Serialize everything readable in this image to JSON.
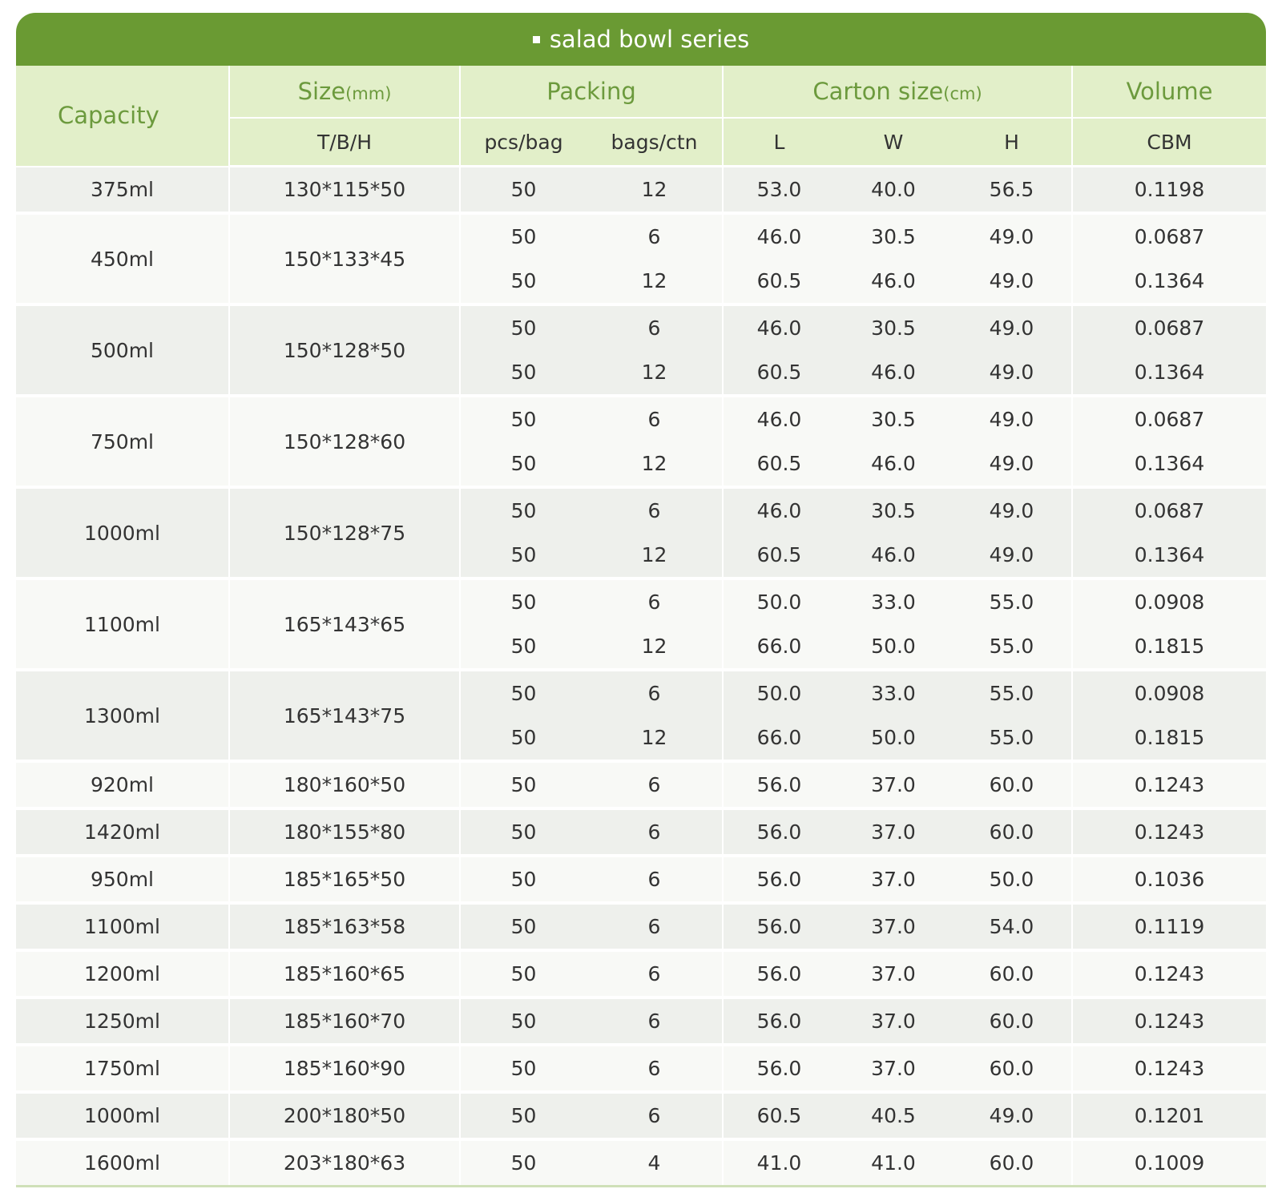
{
  "title": "salad bowl series",
  "header": {
    "capacity": "Capacity",
    "size": "Size",
    "size_unit": "(mm)",
    "size_sub": "T/B/H",
    "packing": "Packing",
    "pcs_bag": "pcs/bag",
    "bags_ctn": "bags/ctn",
    "carton": "Carton size",
    "carton_unit": "(cm)",
    "L": "L",
    "W": "W",
    "H": "H",
    "volume": "Volume",
    "cbm": "CBM"
  },
  "groups": [
    {
      "capacity": "375ml",
      "size": "130*115*50",
      "rows": [
        {
          "pcs": "50",
          "bags": "12",
          "l": "53.0",
          "w": "40.0",
          "h": "56.5",
          "cbm": "0.1198"
        }
      ]
    },
    {
      "capacity": "450ml",
      "size": "150*133*45",
      "rows": [
        {
          "pcs": "50",
          "bags": "6",
          "l": "46.0",
          "w": "30.5",
          "h": "49.0",
          "cbm": "0.0687"
        },
        {
          "pcs": "50",
          "bags": "12",
          "l": "60.5",
          "w": "46.0",
          "h": "49.0",
          "cbm": "0.1364"
        }
      ]
    },
    {
      "capacity": "500ml",
      "size": "150*128*50",
      "rows": [
        {
          "pcs": "50",
          "bags": "6",
          "l": "46.0",
          "w": "30.5",
          "h": "49.0",
          "cbm": "0.0687"
        },
        {
          "pcs": "50",
          "bags": "12",
          "l": "60.5",
          "w": "46.0",
          "h": "49.0",
          "cbm": "0.1364"
        }
      ]
    },
    {
      "capacity": "750ml",
      "size": "150*128*60",
      "rows": [
        {
          "pcs": "50",
          "bags": "6",
          "l": "46.0",
          "w": "30.5",
          "h": "49.0",
          "cbm": "0.0687"
        },
        {
          "pcs": "50",
          "bags": "12",
          "l": "60.5",
          "w": "46.0",
          "h": "49.0",
          "cbm": "0.1364"
        }
      ]
    },
    {
      "capacity": "1000ml",
      "size": "150*128*75",
      "rows": [
        {
          "pcs": "50",
          "bags": "6",
          "l": "46.0",
          "w": "30.5",
          "h": "49.0",
          "cbm": "0.0687"
        },
        {
          "pcs": "50",
          "bags": "12",
          "l": "60.5",
          "w": "46.0",
          "h": "49.0",
          "cbm": "0.1364"
        }
      ]
    },
    {
      "capacity": "1100ml",
      "size": "165*143*65",
      "rows": [
        {
          "pcs": "50",
          "bags": "6",
          "l": "50.0",
          "w": "33.0",
          "h": "55.0",
          "cbm": "0.0908"
        },
        {
          "pcs": "50",
          "bags": "12",
          "l": "66.0",
          "w": "50.0",
          "h": "55.0",
          "cbm": "0.1815"
        }
      ]
    },
    {
      "capacity": "1300ml",
      "size": "165*143*75",
      "rows": [
        {
          "pcs": "50",
          "bags": "6",
          "l": "50.0",
          "w": "33.0",
          "h": "55.0",
          "cbm": "0.0908"
        },
        {
          "pcs": "50",
          "bags": "12",
          "l": "66.0",
          "w": "50.0",
          "h": "55.0",
          "cbm": "0.1815"
        }
      ]
    },
    {
      "capacity": "920ml",
      "size": "180*160*50",
      "rows": [
        {
          "pcs": "50",
          "bags": "6",
          "l": "56.0",
          "w": "37.0",
          "h": "60.0",
          "cbm": "0.1243"
        }
      ]
    },
    {
      "capacity": "1420ml",
      "size": "180*155*80",
      "rows": [
        {
          "pcs": "50",
          "bags": "6",
          "l": "56.0",
          "w": "37.0",
          "h": "60.0",
          "cbm": "0.1243"
        }
      ]
    },
    {
      "capacity": "950ml",
      "size": "185*165*50",
      "rows": [
        {
          "pcs": "50",
          "bags": "6",
          "l": "56.0",
          "w": "37.0",
          "h": "50.0",
          "cbm": "0.1036"
        }
      ]
    },
    {
      "capacity": "1100ml",
      "size": "185*163*58",
      "rows": [
        {
          "pcs": "50",
          "bags": "6",
          "l": "56.0",
          "w": "37.0",
          "h": "54.0",
          "cbm": "0.1119"
        }
      ]
    },
    {
      "capacity": "1200ml",
      "size": "185*160*65",
      "rows": [
        {
          "pcs": "50",
          "bags": "6",
          "l": "56.0",
          "w": "37.0",
          "h": "60.0",
          "cbm": "0.1243"
        }
      ]
    },
    {
      "capacity": "1250ml",
      "size": "185*160*70",
      "rows": [
        {
          "pcs": "50",
          "bags": "6",
          "l": "56.0",
          "w": "37.0",
          "h": "60.0",
          "cbm": "0.1243"
        }
      ]
    },
    {
      "capacity": "1750ml",
      "size": "185*160*90",
      "rows": [
        {
          "pcs": "50",
          "bags": "6",
          "l": "56.0",
          "w": "37.0",
          "h": "60.0",
          "cbm": "0.1243"
        }
      ]
    },
    {
      "capacity": "1000ml",
      "size": "200*180*50",
      "rows": [
        {
          "pcs": "50",
          "bags": "6",
          "l": "60.5",
          "w": "40.5",
          "h": "49.0",
          "cbm": "0.1201"
        }
      ]
    },
    {
      "capacity": "1600ml",
      "size": "203*180*63",
      "rows": [
        {
          "pcs": "50",
          "bags": "4",
          "l": "41.0",
          "w": "41.0",
          "h": "60.0",
          "cbm": "0.1009"
        }
      ]
    }
  ]
}
